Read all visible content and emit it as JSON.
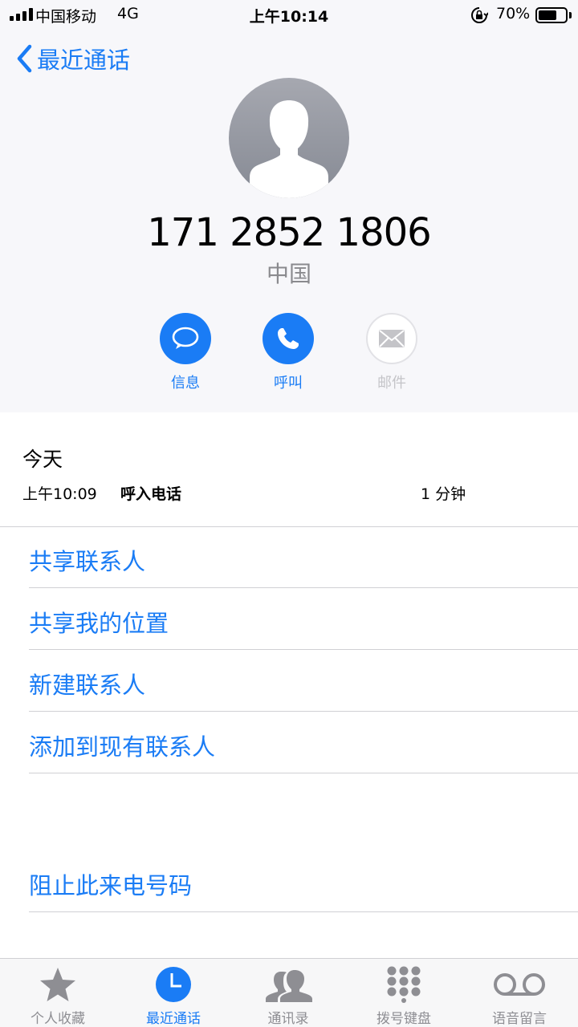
{
  "status_bar": {
    "carrier": "中国移动",
    "network": "4G",
    "time": "上午10:14",
    "battery_pct": "70%",
    "battery_level": 0.7
  },
  "nav": {
    "back_label": "最近通话"
  },
  "contact": {
    "number": "171 2852 1806",
    "country": "中国"
  },
  "actions": [
    {
      "label": "信息",
      "icon": "message-icon",
      "enabled": true
    },
    {
      "label": "呼叫",
      "icon": "phone-icon",
      "enabled": true
    },
    {
      "label": "邮件",
      "icon": "mail-icon",
      "enabled": false
    }
  ],
  "recents": {
    "day": "今天",
    "entries": [
      {
        "time": "上午10:09",
        "type": "呼入电话",
        "duration": "1 分钟"
      }
    ]
  },
  "options": [
    "共享联系人",
    "共享我的位置",
    "新建联系人",
    "添加到现有联系人"
  ],
  "block": "阻止此来电号码",
  "tabs": [
    {
      "label": "个人收藏",
      "icon": "star-icon",
      "active": false
    },
    {
      "label": "最近通话",
      "icon": "clock-icon",
      "active": true
    },
    {
      "label": "通讯录",
      "icon": "contacts-icon",
      "active": false
    },
    {
      "label": "拨号键盘",
      "icon": "keypad-icon",
      "active": false
    },
    {
      "label": "语音留言",
      "icon": "voicemail-icon",
      "active": false
    }
  ],
  "colors": {
    "accent": "#1a7cf5",
    "header_bg": "#f7f7fa",
    "secondary_text": "#8a8a8e",
    "divider": "#d0d0d4"
  }
}
